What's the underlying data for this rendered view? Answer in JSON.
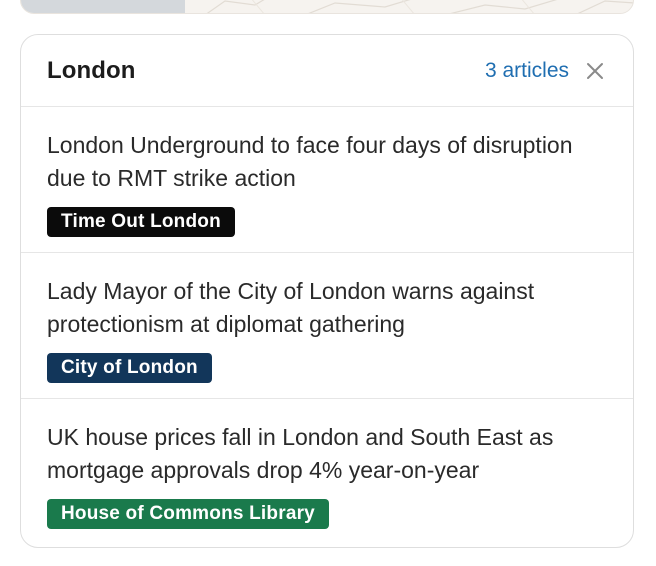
{
  "panel": {
    "title": "London",
    "article_count": "3 articles",
    "close_icon": "close-icon"
  },
  "articles": [
    {
      "title": "London Underground to face four days of disruption due to RMT strike action",
      "source": "Time Out London",
      "source_color": "#0b0b0b"
    },
    {
      "title": "Lady Mayor of the City of London warns against protectionism at diplomat gathering",
      "source": "City of London",
      "source_color": "#12365a"
    },
    {
      "title": "UK house prices fall in London and South East as mortgage approvals drop 4% year-on-year",
      "source": "House of Commons Library",
      "source_color": "#1a7a4c"
    }
  ],
  "colors": {
    "accent_link": "#1f6eb1",
    "border": "#dedede"
  }
}
